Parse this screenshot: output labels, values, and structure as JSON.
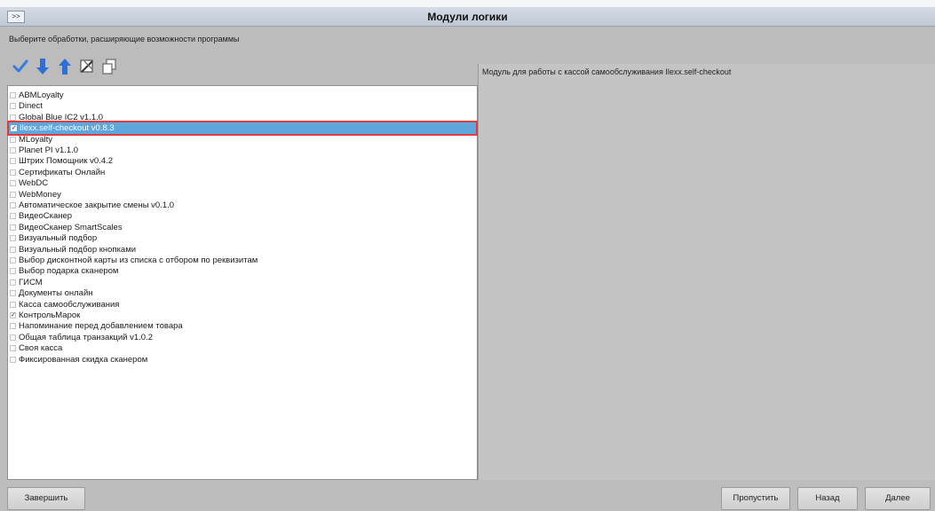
{
  "window": {
    "title": "Модули логики",
    "expand_label": ">>"
  },
  "subtitle": "Выберите обработки, расширяющие возможности программы",
  "toolbar": {
    "icons": [
      "check-all-icon",
      "move-down-icon",
      "move-up-icon",
      "settings-tools-icon",
      "copy-icon"
    ]
  },
  "modules": [
    {
      "label": "ABMLoyalty",
      "checked": false
    },
    {
      "label": "Dinect",
      "checked": false
    },
    {
      "label": "Global Blue IC2 v1.1.0",
      "checked": false
    },
    {
      "label": "Ilexx.self-checkout v0.8.3",
      "checked": true,
      "selected": true
    },
    {
      "label": "MLoyalty",
      "checked": false
    },
    {
      "label": "Planet PI v1.1.0",
      "checked": false
    },
    {
      "label": "Штрих Помощник v0.4.2",
      "checked": false
    },
    {
      "label": "Сертификаты Онлайн",
      "checked": false
    },
    {
      "label": "WebDC",
      "checked": false
    },
    {
      "label": "WebMoney",
      "checked": false
    },
    {
      "label": "Автоматическое закрытие смены v0.1.0",
      "checked": false
    },
    {
      "label": "ВидеоСканер",
      "checked": false
    },
    {
      "label": "ВидеоСканер SmartScales",
      "checked": false
    },
    {
      "label": "Визуальный подбор",
      "checked": false
    },
    {
      "label": "Визуальный подбор кнопками",
      "checked": false
    },
    {
      "label": "Выбор дисконтной карты из списка с отбором по реквизитам",
      "checked": false
    },
    {
      "label": "Выбор подарка сканером",
      "checked": false
    },
    {
      "label": "ГИСМ",
      "checked": false
    },
    {
      "label": "Документы онлайн",
      "checked": false
    },
    {
      "label": "Касса самообслуживания",
      "checked": false
    },
    {
      "label": "КонтрольМарок",
      "checked": true
    },
    {
      "label": "Напоминание перед добавлением товара",
      "checked": false
    },
    {
      "label": "Общая таблица транзакций v1.0.2",
      "checked": false
    },
    {
      "label": "Своя касса",
      "checked": false
    },
    {
      "label": "Фиксированная скидка сканером",
      "checked": false
    }
  ],
  "description": "Модуль для работы с кассой самообслуживания Ilexx.self-checkout",
  "footer": {
    "finish_label": "Завершить",
    "skip_label": "Пропустить",
    "back_label": "Назад",
    "next_label": "Далее"
  },
  "colors": {
    "selection": "#5ea7dd",
    "highlight_outline": "#e33b3b",
    "icon_blue": "#2f6fd6",
    "icon_check": "#3a7be0"
  }
}
